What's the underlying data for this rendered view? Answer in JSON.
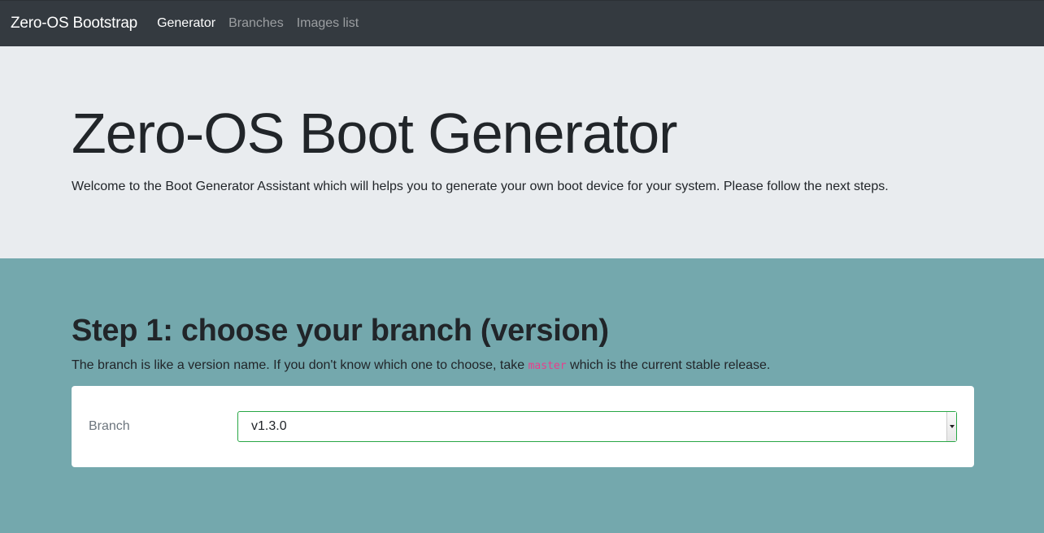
{
  "navbar": {
    "brand": "Zero-OS Bootstrap",
    "links": [
      {
        "label": "Generator",
        "active": true
      },
      {
        "label": "Branches",
        "active": false
      },
      {
        "label": "Images list",
        "active": false
      }
    ]
  },
  "hero": {
    "title": "Zero-OS Boot Generator",
    "description": "Welcome to the Boot Generator Assistant which will helps you to generate your own boot device for your system. Please follow the next steps."
  },
  "step1": {
    "title": "Step 1: choose your branch (version)",
    "text_before": "The branch is like a version name. If you don't know which one to choose, take ",
    "code": "master",
    "text_after": " which is the current stable release.",
    "field_label": "Branch",
    "selected_value": "v1.3.0"
  },
  "colors": {
    "navbar_bg": "#343a40",
    "hero_bg": "#e9ecef",
    "section_bg": "#74a8ad",
    "select_border": "#28a745",
    "code_color": "#e83e8c"
  },
  "icons": {
    "select_arrow": "chevron-down-icon"
  }
}
